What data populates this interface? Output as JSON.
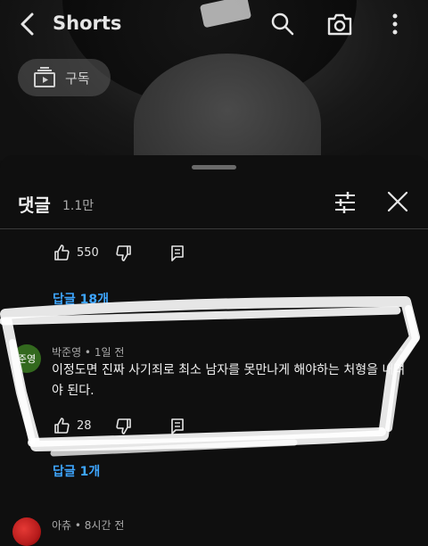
{
  "header": {
    "title": "Shorts",
    "subscribe_label": "구독"
  },
  "comments_panel": {
    "title": "댓글",
    "count": "1.1만",
    "comments": [
      {
        "likes": "550",
        "replies": "답글 18개"
      },
      {
        "avatar_text": "준영",
        "author_time": "박준영 • 1일 전",
        "text": "이정도면 진짜 사기죄로 최소 남자를 못만나게 해야하는 처형을 내려야 된다.",
        "likes": "28",
        "replies": "답글 1개"
      },
      {
        "author_time": "아츄 • 8시간 전"
      }
    ]
  },
  "colors": {
    "background": "#0f0f0f",
    "link": "#3ea6ff",
    "avatar": "#33691e"
  }
}
